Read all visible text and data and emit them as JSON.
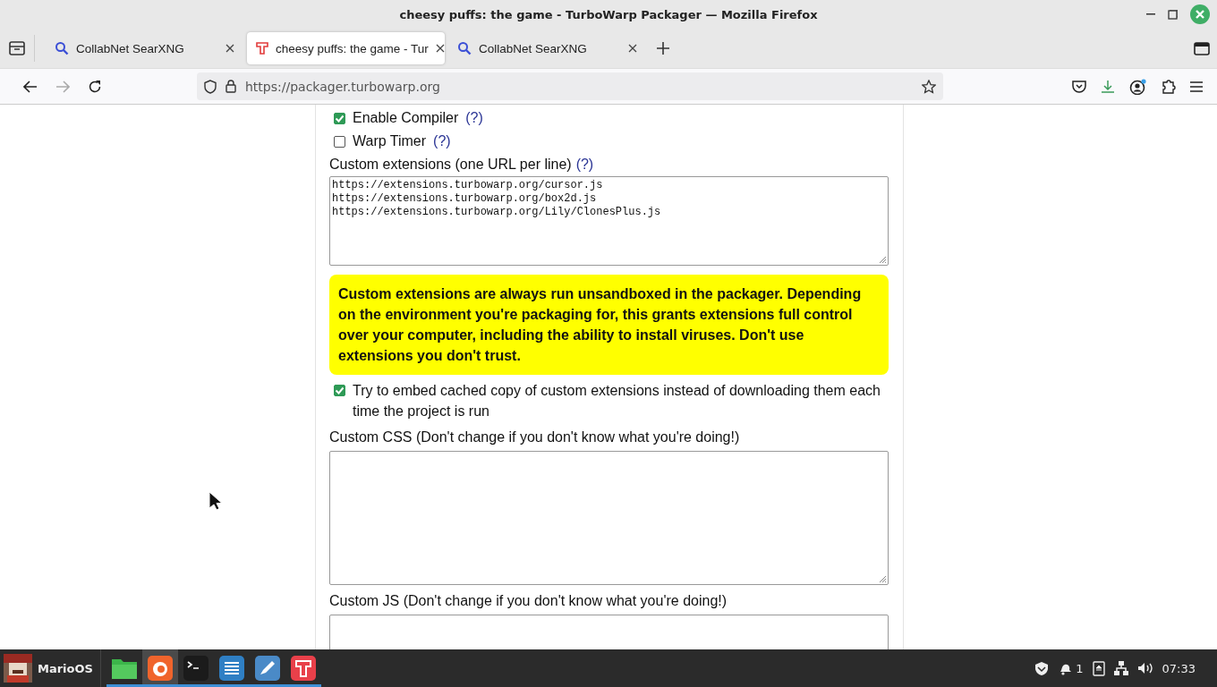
{
  "window": {
    "title": "cheesy puffs: the game - TurboWarp Packager — Mozilla Firefox"
  },
  "tabs": [
    {
      "label": "CollabNet SearXNG",
      "kind": "search",
      "selected": false
    },
    {
      "label": "cheesy puffs: the game - Tur",
      "kind": "turbowarp",
      "selected": true
    },
    {
      "label": "CollabNet SearXNG",
      "kind": "search",
      "selected": false
    }
  ],
  "address_bar": {
    "url": "https://packager.turbowarp.org"
  },
  "options": [
    {
      "label": "Enable Compiler",
      "help": "(?)",
      "checked": true
    },
    {
      "label": "Warp Timer",
      "help": "(?)",
      "checked": false
    }
  ],
  "extensions": {
    "label": "Custom extensions (one URL per line)",
    "help": "(?)",
    "lines": [
      "https://extensions.turbowarp.org/cursor.js",
      "https://extensions.turbowarp.org/box2d.js",
      "https://extensions.turbowarp.org/Lily/ClonesPlus.js"
    ]
  },
  "warning": "Custom extensions are always run unsandboxed in the packager. Depending on the environment you're packaging for, this grants extensions full control over your computer, including the ability to install viruses. Don't use extensions you don't trust.",
  "embed_option": {
    "label": "Try to embed cached copy of custom extensions instead of downloading them each time the project is run",
    "checked": true
  },
  "custom_css": {
    "label": "Custom CSS (Don't change if you don't know what you're doing!)"
  },
  "custom_js": {
    "label": "Custom JS (Don't change if you don't know what you're doing!)"
  },
  "taskbar": {
    "start_label": "MarioOS",
    "apps": [
      {
        "kind": "folder",
        "selected": false
      },
      {
        "kind": "firefox",
        "selected": true
      },
      {
        "kind": "terminal",
        "selected": false
      },
      {
        "kind": "notes",
        "selected": false
      },
      {
        "kind": "editor",
        "selected": false
      },
      {
        "kind": "turbowarp",
        "selected": false
      }
    ],
    "notification_count": "1",
    "clock": "07:33"
  }
}
